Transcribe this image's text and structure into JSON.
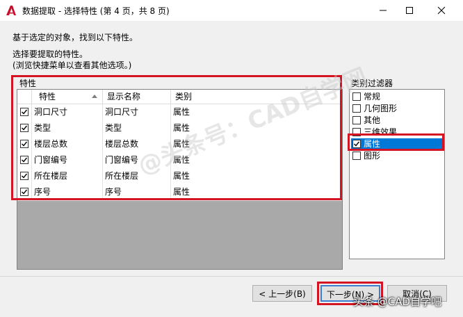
{
  "window": {
    "title": "数据提取 - 选择特性 (第 4 页，共 8 页)"
  },
  "intro": {
    "line1": "基于选定的对象，找到以下特性。",
    "line2": "选择要提取的特性。",
    "line3": "(浏览快捷菜单以查看其他选项。)"
  },
  "properties": {
    "label": "特性",
    "columns": [
      "特性",
      "显示名称",
      "类别"
    ],
    "rows": [
      {
        "checked": true,
        "name": "洞口尺寸",
        "display": "洞口尺寸",
        "category": "属性"
      },
      {
        "checked": true,
        "name": "类型",
        "display": "类型",
        "category": "属性"
      },
      {
        "checked": true,
        "name": "楼层总数",
        "display": "楼层总数",
        "category": "属性"
      },
      {
        "checked": true,
        "name": "门窗编号",
        "display": "门窗编号",
        "category": "属性"
      },
      {
        "checked": true,
        "name": "所在楼层",
        "display": "所在楼层",
        "category": "属性"
      },
      {
        "checked": true,
        "name": "序号",
        "display": "序号",
        "category": "属性"
      }
    ]
  },
  "filter": {
    "label": "类别过滤器",
    "items": [
      {
        "label": "常规",
        "checked": false,
        "selected": false
      },
      {
        "label": "几何图形",
        "checked": false,
        "selected": false
      },
      {
        "label": "其他",
        "checked": false,
        "selected": false
      },
      {
        "label": "三维效果",
        "checked": false,
        "selected": false
      },
      {
        "label": "属性",
        "checked": true,
        "selected": true
      },
      {
        "label": "图形",
        "checked": false,
        "selected": false
      }
    ]
  },
  "buttons": {
    "back": "< 上一步(B)",
    "next": "下一步(N) >",
    "cancel": "取消(C)"
  },
  "watermarks": {
    "center": "@头条号：CAD自学网",
    "corner": "头条 @CAD自学吧"
  },
  "colors": {
    "highlight": "#d41422",
    "selection": "#0078d7",
    "logo": "#c8102e"
  }
}
